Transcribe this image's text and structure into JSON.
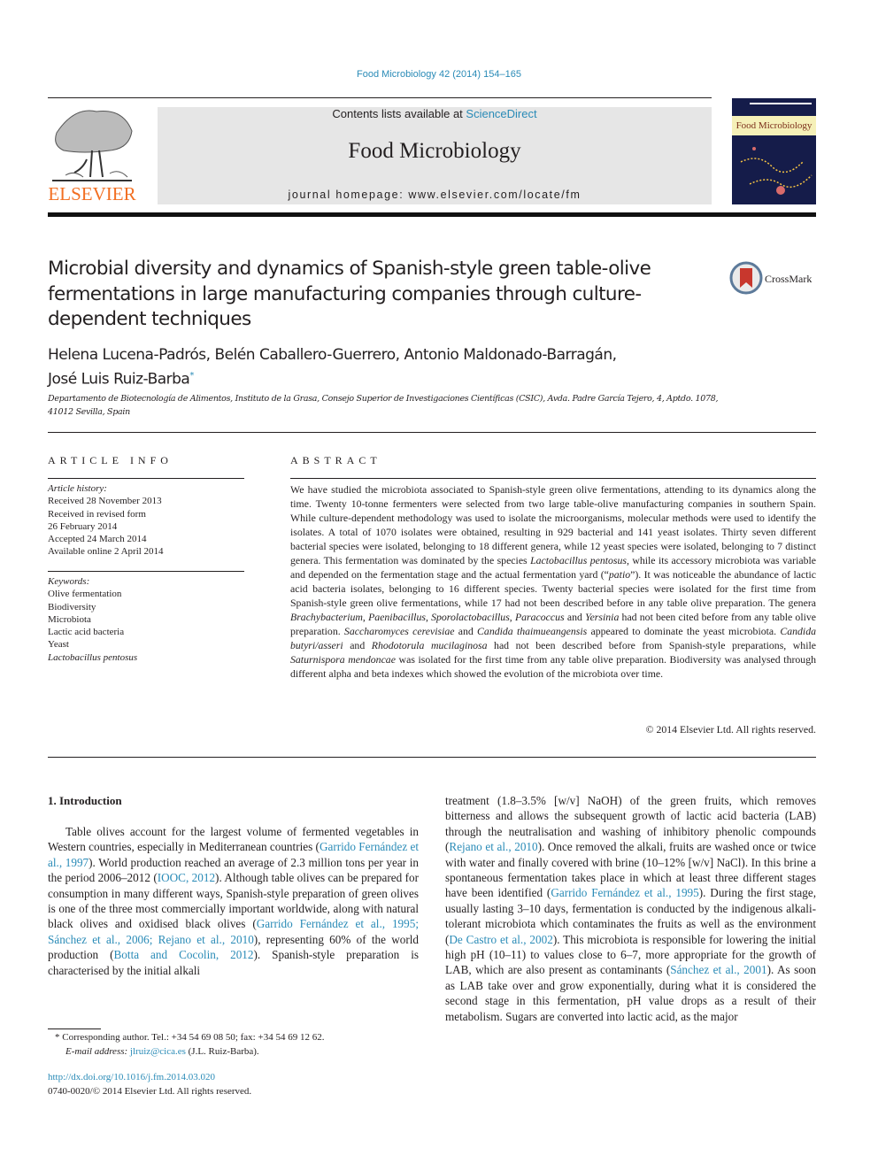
{
  "header": {
    "journal_ref": "Food Microbiology 42 (2014) 154–165",
    "publisher_logo": "ELSEVIER",
    "contents_prefix": "Contents lists available at ",
    "contents_link": "ScienceDirect",
    "journal_title": "Food Microbiology",
    "homepage": "journal homepage: www.elsevier.com/locate/fm",
    "cover_title": "Food Microbiology"
  },
  "crossmark": {
    "label": "CrossMark"
  },
  "article": {
    "title": "Microbial diversity and dynamics of Spanish-style green table-olive fermentations in large manufacturing companies through culture-dependent techniques",
    "authors_line1": "Helena Lucena-Padrós, Belén Caballero-Guerrero, Antonio Maldonado-Barragán,",
    "authors_line2": "José Luis Ruiz-Barba",
    "corresponding_mark": "*",
    "affiliation": "Departamento de Biotecnología de Alimentos, Instituto de la Grasa, Consejo Superior de Investigaciones Científicas (CSIC), Avda. Padre García Tejero, 4, Aptdo. 1078, 41012 Sevilla, Spain"
  },
  "article_info": {
    "heading": "ARTICLE INFO",
    "history_label": "Article history:",
    "history": [
      "Received 28 November 2013",
      "Received in revised form",
      "26 February 2014",
      "Accepted 24 March 2014",
      "Available online 2 April 2014"
    ],
    "keywords_label": "Keywords:",
    "keywords": [
      "Olive fermentation",
      "Biodiversity",
      "Microbiota",
      "Lactic acid bacteria",
      "Yeast",
      "Lactobacillus pentosus"
    ]
  },
  "abstract": {
    "heading": "ABSTRACT",
    "parts": [
      "We have studied the microbiota associated to Spanish-style green olive fermentations, attending to its dynamics along the time. Twenty 10-tonne fermenters were selected from two large table-olive manufacturing companies in southern Spain. While culture-dependent methodology was used to isolate the microorganisms, molecular methods were used to identify the isolates. A total of 1070 isolates were obtained, resulting in 929 bacterial and 141 yeast isolates. Thirty seven different bacterial species were isolated, belonging to 18 different genera, while 12 yeast species were isolated, belonging to 7 distinct genera. This fermentation was dominated by the species ",
      "Lactobacillus pentosus",
      ", while its accessory microbiota was variable and depended on the fermentation stage and the actual fermentation yard (“",
      "patio",
      "”). It was noticeable the abundance of lactic acid bacteria isolates, belonging to 16 different species. Twenty bacterial species were isolated for the first time from Spanish-style green olive fermentations, while 17 had not been described before in any table olive preparation. The genera ",
      "Brachybacterium",
      ", ",
      "Paenibacillus",
      ", ",
      "Sporolactobacillus",
      ", ",
      "Paracoccus",
      " and ",
      "Yersinia",
      " had not been cited before from any table olive preparation. ",
      "Saccharomyces cerevisiae",
      " and ",
      "Candida thaimueangensis",
      " appeared to dominate the yeast microbiota. ",
      "Candida butyri/asseri",
      " and ",
      "Rhodotorula mucilaginosa",
      " had not been described before from Spanish-style preparations, while ",
      "Saturnispora mendoncae",
      " was isolated for the first time from any table olive preparation. Biodiversity was analysed through different alpha and beta indexes which showed the evolution of the microbiota over time."
    ],
    "copyright": "© 2014 Elsevier Ltd. All rights reserved."
  },
  "introduction": {
    "heading": "1.  Introduction",
    "left": [
      "Table olives account for the largest volume of fermented vegetables in Western countries, especially in Mediterranean countries (",
      "Garrido Fernández et al., 1997",
      "). World production reached an average of 2.3 million tons per year in the period 2006–2012 (",
      "IOOC, 2012",
      "). Although table olives can be prepared for consumption in many different ways, Spanish-style preparation of green olives is one of the three most commercially important worldwide, along with natural black olives and oxidised black olives (",
      "Garrido Fernández et al., 1995; Sánchez et al., 2006; Rejano et al., 2010",
      "), representing 60% of the world production (",
      "Botta and Cocolin, 2012",
      "). Spanish-style preparation is characterised by the initial alkali"
    ],
    "right": [
      "treatment (1.8–3.5% [w/v] NaOH) of the green fruits, which removes bitterness and allows the subsequent growth of lactic acid bacteria (LAB) through the neutralisation and washing of inhibitory phenolic compounds (",
      "Rejano et al., 2010",
      "). Once removed the alkali, fruits are washed once or twice with water and finally covered with brine (10–12% [w/v] NaCl). In this brine a spontaneous fermentation takes place in which at least three different stages have been identified (",
      "Garrido Fernández et al., 1995",
      "). During the first stage, usually lasting 3–10 days, fermentation is conducted by the indigenous alkali-tolerant microbiota which contaminates the fruits as well as the environment (",
      "De Castro et al., 2002",
      "). This microbiota is responsible for lowering the initial high pH (10–11) to values close to 6–7, more appropriate for the growth of LAB, which are also present as contaminants (",
      "Sánchez et al., 2001",
      "). As soon as LAB take over and grow exponentially, during what it is considered the second stage in this fermentation, pH value drops as a result of their metabolism. Sugars are converted into lactic acid, as the major"
    ]
  },
  "footnote": {
    "mark": "*",
    "corresponding": "Corresponding author. Tel.: +34 54 69 08 50; fax: +34 54 69 12 62.",
    "email_label": "E-mail address:",
    "email": "jlruiz@cica.es",
    "email_suffix": " (J.L. Ruiz-Barba).",
    "doi": "http://dx.doi.org/10.1016/j.fm.2014.03.020",
    "issn": "0740-0020/© 2014 Elsevier Ltd. All rights reserved."
  },
  "colors": {
    "link": "#2a8bb7",
    "elsevier_orange": "#f26f22",
    "masthead_gray": "#e6e6e6"
  }
}
